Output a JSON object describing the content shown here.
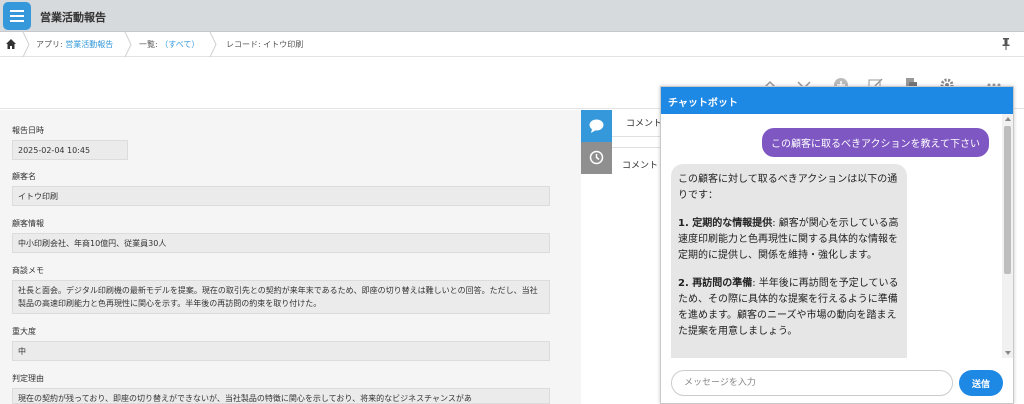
{
  "header": {
    "app_title": "営業活動報告",
    "app_icon": "list-icon"
  },
  "breadcrumb": {
    "app_prefix": "アプリ: ",
    "app_name": "営業活動報告",
    "list_prefix": "一覧: ",
    "list_name": "（すべて）",
    "record": "レコード: イトウ印刷"
  },
  "record": {
    "fields": [
      {
        "label": "報告日時",
        "value": "2025-02-04 10:45"
      },
      {
        "label": "顧客名",
        "value": "イトウ印刷"
      },
      {
        "label": "顧客情報",
        "value": "中小印刷会社、年商10億円、従業員30人"
      },
      {
        "label": "商談メモ",
        "value": "社長と面会。デジタル印刷機の最新モデルを提案。現在の取引先との契約が来年末であるため、即座の切り替えは難しいとの回答。ただし、当社製品の高速印刷能力と色再現性に関心を示す。半年後の再訪問の約束を取り付けた。"
      },
      {
        "label": "重大度",
        "value": "中"
      },
      {
        "label": "判定理由",
        "value": "現在の契約が残っており、即座の切り替えができないが、当社製品の特徴に関心を示しており、将来的なビジネスチャンスがあ"
      }
    ]
  },
  "comments": {
    "tab_label": "コメント",
    "input_label": "コメント"
  },
  "chatbot": {
    "title": "チャットボット",
    "user_message": "この顧客に取るべきアクションを教えて下さい",
    "bot_intro": "この顧客に対して取るべきアクションは以下の通りです：",
    "bot_item1_title": "1. 定期的な情報提供",
    "bot_item1_text": ": 顧客が関心を示している高速度印刷能力と色再現性に関する具体的な情報を定期的に提供し、関係を維持・強化します。",
    "bot_item2_title": "2. 再訪問の準備",
    "bot_item2_text": ": 半年後に再訪問を予定しているため、その際に具体的な提案を行えるように準備を進めます。顧客のニーズや市場の動向を踏まえた提案を用意しましょう。",
    "input_placeholder": "メッセージを入力",
    "send_label": "送信"
  },
  "colors": {
    "accent": "#1e88e5",
    "user_bubble": "#7e57c2",
    "link": "#3498db",
    "side_tab_active": "#3498db",
    "side_tab_inactive": "#8f8f8f"
  }
}
